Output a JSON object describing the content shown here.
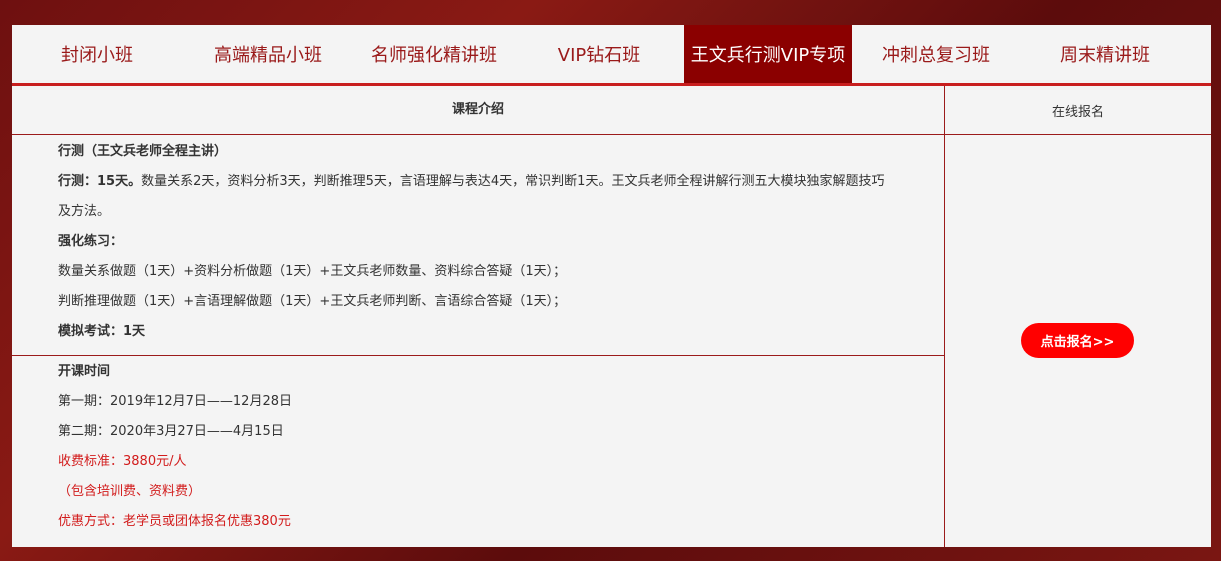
{
  "tabs": [
    {
      "label": "封闭小班",
      "active": false
    },
    {
      "label": "高端精品小班",
      "active": false
    },
    {
      "label": "名师强化精讲班",
      "active": false
    },
    {
      "label": "VIP钻石班",
      "active": false
    },
    {
      "label": "王文兵行测VIP专项",
      "active": true
    },
    {
      "label": "冲刺总复习班",
      "active": false
    },
    {
      "label": "周末精讲班",
      "active": false
    }
  ],
  "table": {
    "header_left": "课程介绍",
    "header_right": "在线报名"
  },
  "course": {
    "title": "行测（王文兵老师全程主讲）",
    "summary_label": "行测：15天。",
    "summary_text": "数量关系2天，资料分析3天，判断推理5天，言语理解与表达4天，常识判断1天。王文兵老师全程讲解行测五大模块独家解题技巧",
    "summary_cont": "及方法。",
    "practice_label": "强化练习：",
    "practice_1": "数量关系做题（1天）+资料分析做题（1天）+王文兵老师数量、资料综合答疑（1天）；",
    "practice_2": "判断推理做题（1天）+言语理解做题（1天）+王文兵老师判断、言语综合答疑（1天）；",
    "exam": "模拟考试：1天"
  },
  "schedule": {
    "title": "开课时间",
    "session_1": "第一期：2019年12月7日——12月28日",
    "session_2": "第二期：2020年3月27日——4月15日",
    "fee": "收费标准：3880元/人",
    "fee_note": "（包含培训费、资料费）",
    "discount": "优惠方式：老学员或团体报名优惠380元"
  },
  "register_button": "点击报名>>",
  "colors": {
    "accent": "#8b0000",
    "border": "#9b1b1b",
    "highlight": "#d21c1c",
    "button": "#ff0000"
  }
}
